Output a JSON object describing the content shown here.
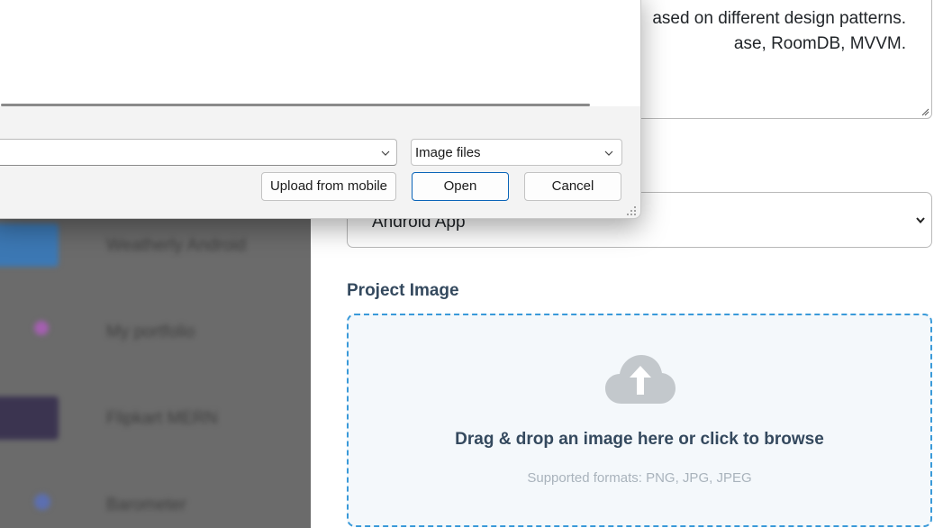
{
  "background_list": {
    "items": [
      {
        "label": "Weatherly Android",
        "thumb": "#3c78b4",
        "accent": "#5ba0df"
      },
      {
        "label": "My portfolio",
        "thumb": "#6b6b6b",
        "accent": "#a45fb0"
      },
      {
        "label": "Flipkart MERN",
        "thumb": "#3b3450",
        "accent": "#6a4a6a"
      },
      {
        "label": "Barometer",
        "thumb": "#6b6b6b",
        "accent": "#5c6fb0"
      }
    ]
  },
  "form": {
    "description": {
      "line1": "ased on different design patterns.",
      "line2": "ase, RoomDB, MVVM."
    },
    "project_type": {
      "value": "Android App"
    },
    "project_image": {
      "label": "Project Image",
      "drop_text": "Drag & drop an image here or click to browse",
      "formats_text": "Supported formats: PNG, JPG, JPEG",
      "icon": "cloud-upload-icon"
    }
  },
  "dialog": {
    "filename_value": "",
    "file_type_filter": "Image files",
    "buttons": {
      "upload_from_mobile": "Upload from mobile",
      "open": "Open",
      "cancel": "Cancel"
    }
  },
  "colors": {
    "accent": "#3a9ad9",
    "heading": "#34495e",
    "muted": "#a9b3bc",
    "open_border": "#0a64b8"
  }
}
